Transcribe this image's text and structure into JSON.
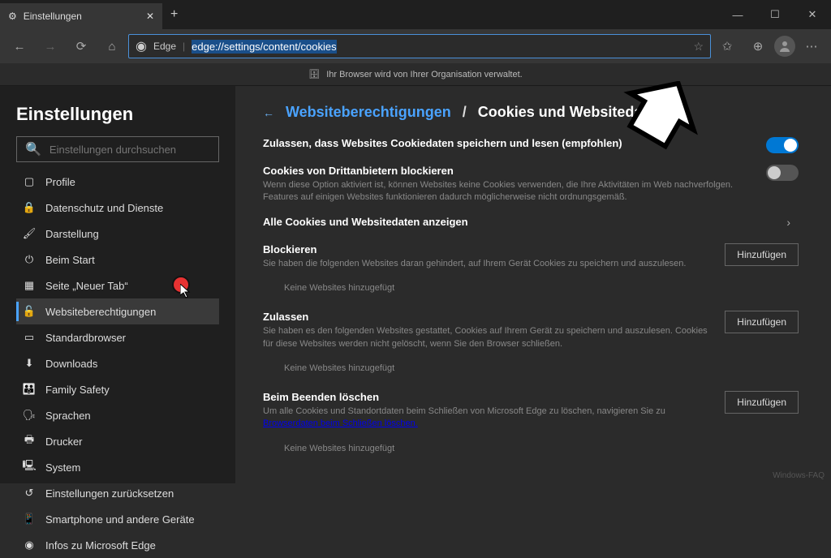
{
  "window": {
    "tab_title": "Einstellungen",
    "url_prefix": "Edge",
    "url": "edge://settings/content/cookies"
  },
  "orgbar": "Ihr Browser wird von Ihrer Organisation verwaltet.",
  "sidebar": {
    "heading": "Einstellungen",
    "search_placeholder": "Einstellungen durchsuchen",
    "items": [
      "Profile",
      "Datenschutz und Dienste",
      "Darstellung",
      "Beim Start",
      "Seite „Neuer Tab“",
      "Websiteberechtigungen",
      "Standardbrowser",
      "Downloads",
      "Family Safety",
      "Sprachen",
      "Drucker",
      "System",
      "Einstellungen zurücksetzen",
      "Smartphone und andere Geräte",
      "Infos zu Microsoft Edge"
    ],
    "active_index": 5
  },
  "breadcrumb": {
    "link": "Websiteberechtigungen",
    "current": "Cookies und Websitedaten"
  },
  "rows": {
    "allow": {
      "title": "Zulassen, dass Websites Cookiedaten speichern und lesen (empfohlen)"
    },
    "block3p": {
      "title": "Cookies von Drittanbietern blockieren",
      "desc": "Wenn diese Option aktiviert ist, können Websites keine Cookies verwenden, die Ihre Aktivitäten im Web nachverfolgen. Features auf einigen Websites funktionieren dadurch möglicherweise nicht ordnungsgemäß."
    },
    "viewall": {
      "title": "Alle Cookies und Websitedaten anzeigen"
    }
  },
  "sections": {
    "block": {
      "title": "Blockieren",
      "desc": "Sie haben die folgenden Websites daran gehindert, auf Ihrem Gerät Cookies zu speichern und auszulesen.",
      "empty": "Keine Websites hinzugefügt",
      "add": "Hinzufügen"
    },
    "allow": {
      "title": "Zulassen",
      "desc": "Sie haben es den folgenden Websites gestattet, Cookies auf Ihrem Gerät zu speichern und auszulesen. Cookies für diese Websites werden nicht gelöscht, wenn Sie den Browser schließen.",
      "empty": "Keine Websites hinzugefügt",
      "add": "Hinzufügen"
    },
    "onexit": {
      "title": "Beim Beenden löschen",
      "desc_pre": "Um alle Cookies und Standortdaten beim Schließen von Microsoft Edge zu löschen, navigieren Sie zu ",
      "desc_link": "Browserdaten beim Schließen löschen.",
      "empty": "Keine Websites hinzugefügt",
      "add": "Hinzufügen"
    }
  },
  "watermark": "Windows-FAQ"
}
